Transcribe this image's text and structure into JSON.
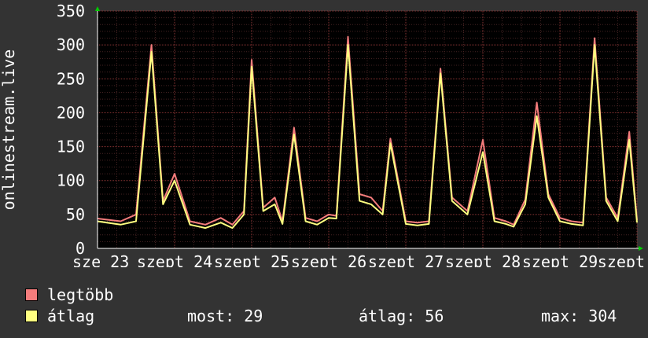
{
  "chart_data": {
    "type": "line",
    "ylabel": "onlinestream.live",
    "ylim": [
      0,
      350
    ],
    "yticks": [
      0,
      50,
      100,
      150,
      200,
      250,
      300,
      350
    ],
    "xticks": [
      "sze 23",
      "szept 24",
      "szept 25",
      "szept 26",
      "szept 27",
      "szept 28",
      "szept 29",
      "szept"
    ],
    "grid": true,
    "x": [
      0,
      0.3,
      0.5,
      0.7,
      0.85,
      1.0,
      1.2,
      1.4,
      1.6,
      1.75,
      1.9,
      2.0,
      2.15,
      2.3,
      2.4,
      2.55,
      2.7,
      2.85,
      3.0,
      3.1,
      3.25,
      3.4,
      3.55,
      3.7,
      3.8,
      4.0,
      4.15,
      4.3,
      4.45,
      4.6,
      4.8,
      5.0,
      5.15,
      5.3,
      5.4,
      5.55,
      5.7,
      5.85,
      6.0,
      6.15,
      6.3,
      6.45,
      6.6,
      6.75,
      6.9,
      7.0
    ],
    "series": [
      {
        "name": "legtöbb",
        "color": "#f47c7c",
        "values": [
          44,
          40,
          50,
          300,
          70,
          110,
          40,
          35,
          45,
          35,
          55,
          278,
          60,
          75,
          40,
          178,
          45,
          40,
          50,
          48,
          312,
          80,
          75,
          55,
          162,
          40,
          38,
          40,
          265,
          75,
          55,
          160,
          45,
          40,
          35,
          72,
          215,
          80,
          45,
          40,
          38,
          310,
          75,
          45,
          172,
          42
        ]
      },
      {
        "name": "átlag",
        "color": "#ffff80",
        "values": [
          40,
          35,
          40,
          290,
          65,
          100,
          35,
          30,
          38,
          30,
          50,
          268,
          55,
          65,
          36,
          168,
          40,
          35,
          45,
          44,
          300,
          70,
          65,
          50,
          155,
          36,
          34,
          36,
          258,
          70,
          50,
          142,
          40,
          36,
          32,
          65,
          195,
          75,
          40,
          36,
          34,
          300,
          70,
          40,
          160,
          38
        ]
      }
    ]
  },
  "legend": [
    {
      "label": "legtöbb",
      "color": "#f47c7c"
    },
    {
      "label": "átlag",
      "color": "#ffff80"
    }
  ],
  "stats": {
    "current": "most: 29",
    "average": "átlag: 56",
    "max": "max: 304"
  }
}
